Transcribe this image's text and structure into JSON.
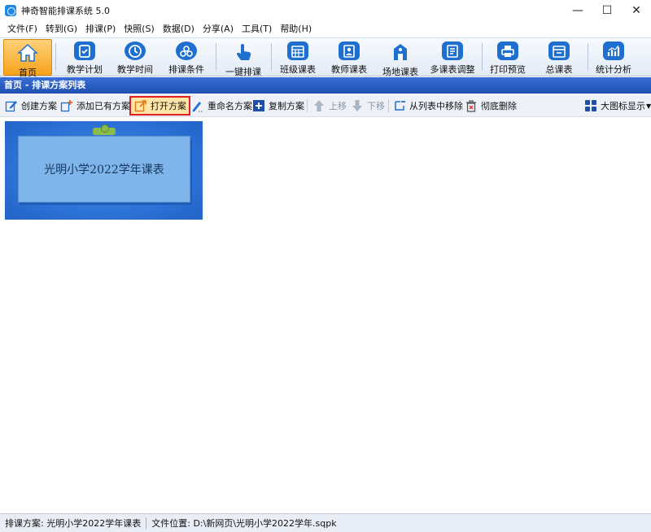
{
  "window": {
    "title": "神奇智能排课系统 5.0",
    "minimize_glyph": "—",
    "maximize_glyph": "☐",
    "close_glyph": "✕"
  },
  "menu": [
    "文件(F)",
    "转到(G)",
    "排课(P)",
    "快照(S)",
    "数据(D)",
    "分享(A)",
    "工具(T)",
    "帮助(H)"
  ],
  "toolbar": {
    "home": "首页",
    "teaching_plan": "教学计划",
    "teaching_time": "教学时间",
    "schedule_conditions": "排课条件",
    "one_click": "一键排课",
    "class_schedule": "班级课表",
    "teacher_schedule": "教师课表",
    "venue_schedule": "场地课表",
    "multi_adjust": "多课表调整",
    "print_preview": "打印预览",
    "master_schedule": "总课表",
    "statistics": "统计分析"
  },
  "section": {
    "title": "首页 - 排课方案列表"
  },
  "actions": {
    "create": "创建方案",
    "add_existing": "添加已有方案",
    "open": "打开方案",
    "rename": "重命名方案",
    "copy": "复制方案",
    "move_up": "上移",
    "move_down": "下移",
    "remove_from_list": "从列表中移除",
    "delete": "彻底删除",
    "view_mode": "大图标显示"
  },
  "plans": [
    {
      "title": "光明小学2022学年课表"
    }
  ],
  "status": {
    "plan_label": "排课方案:",
    "plan_value": "光明小学2022学年课表",
    "location_label": "文件位置:",
    "location_value": "D:\\新网页\\光明小学2022学年.sqpk"
  },
  "colors": {
    "accent_blue": "#1e6fd0",
    "header_blue": "#2a5bc0",
    "active_orange": "#f7a21a",
    "highlight_red": "#e02020"
  }
}
